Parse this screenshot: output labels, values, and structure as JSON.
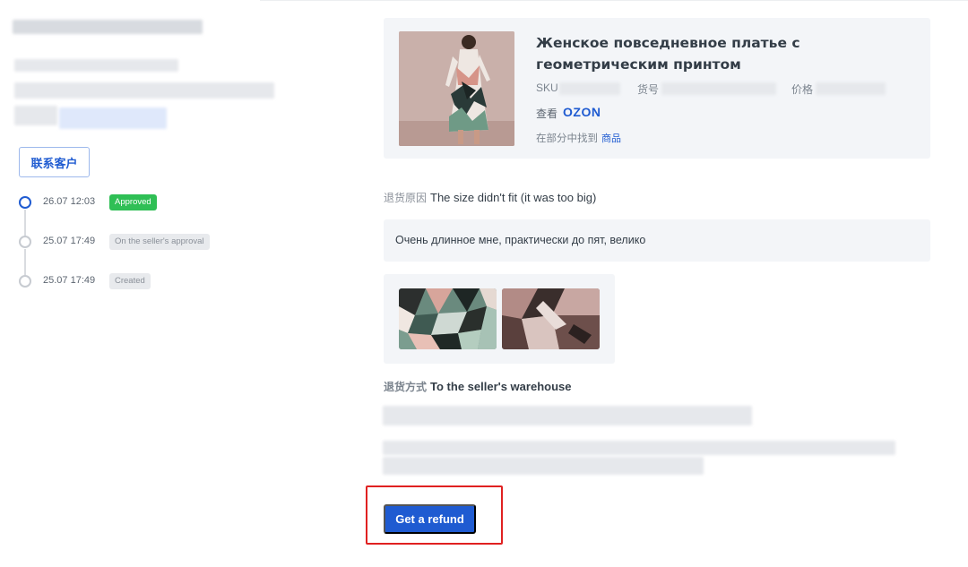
{
  "sidebar": {
    "contact_button": "联系客户",
    "timeline": [
      {
        "time": "26.07 12:03",
        "status": "Approved",
        "color": "#2fbf55"
      },
      {
        "time": "25.07 17:49",
        "status": "On the seller's approval"
      },
      {
        "time": "25.07 17:49",
        "status": "Created"
      }
    ]
  },
  "product": {
    "title": "Женское повседневное платье с геометрическим принтом",
    "sku_label": "SKU",
    "article_label": "货号",
    "price_label": "价格",
    "view_label": "查看",
    "ozon_logo": "OZON",
    "find_label": "在部分中找到",
    "find_link": "商品"
  },
  "return_info": {
    "reason_label": "退货原因",
    "reason_value": "The size didn't fit (it was too big)",
    "comment": "Очень длинное мне, практически до пят, велико",
    "method_label": "退货方式",
    "method_value": "To the seller's warehouse"
  },
  "actions": {
    "refund_button": "Get a refund"
  },
  "colors": {
    "accent": "#1f5bd1",
    "approved": "#2fbf55",
    "highlight": "#e02121"
  }
}
